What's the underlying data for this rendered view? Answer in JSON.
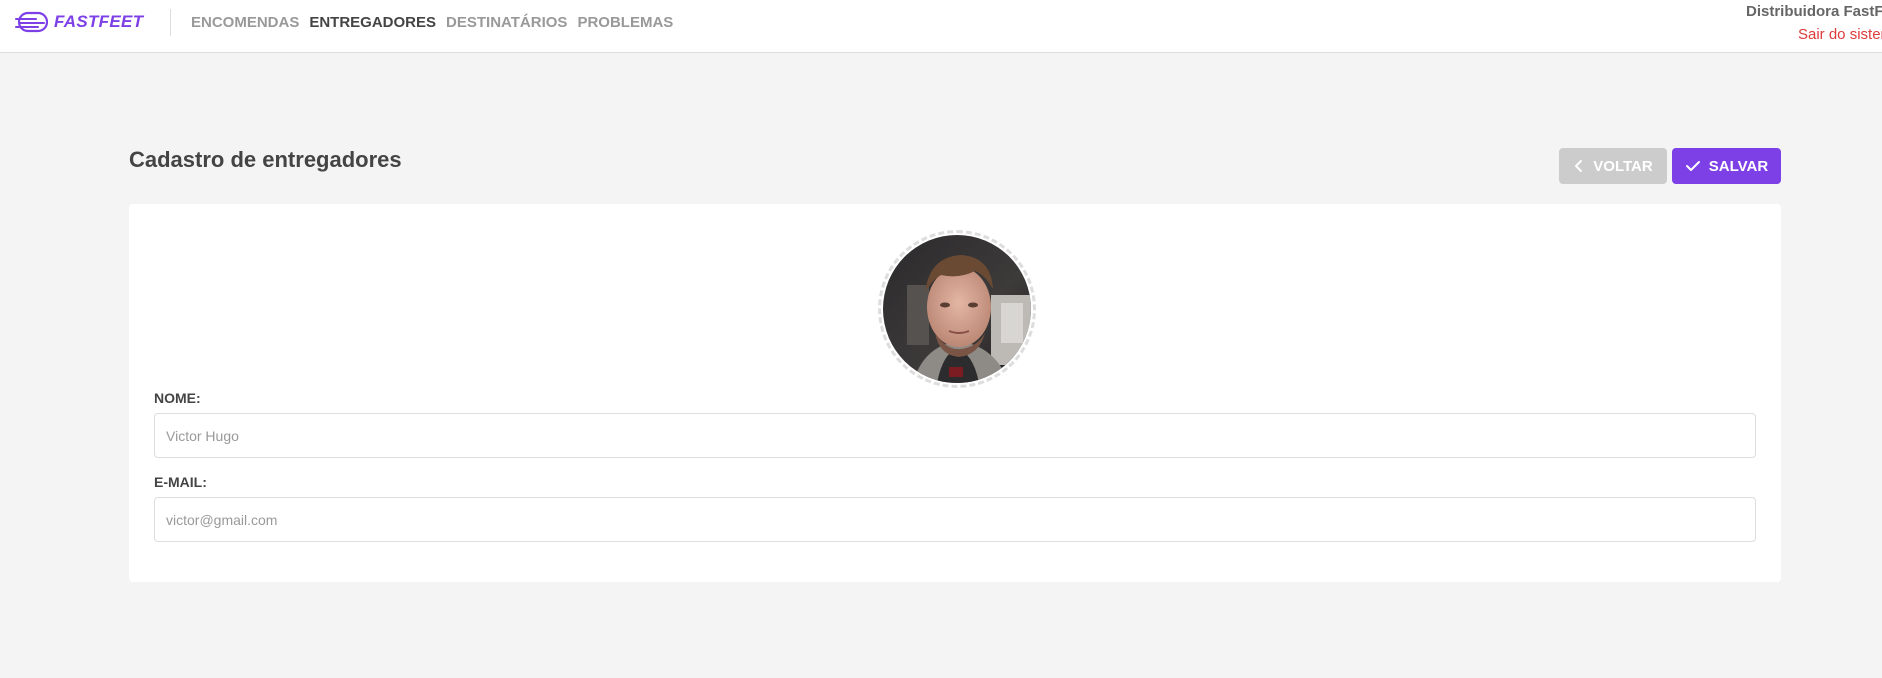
{
  "app": {
    "logo_text": "FASTFEET",
    "brand_color": "#7d40e7"
  },
  "nav": {
    "items": [
      {
        "label": "ENCOMENDAS",
        "active": false
      },
      {
        "label": "ENTREGADORES",
        "active": true
      },
      {
        "label": "DESTINATÁRIOS",
        "active": false
      },
      {
        "label": "PROBLEMAS",
        "active": false
      }
    ]
  },
  "profile": {
    "name": "Distribuidora FastFeet",
    "logout_label": "Sair do sistema",
    "logout_color": "#de3b3b"
  },
  "page": {
    "title": "Cadastro de entregadores"
  },
  "actions": {
    "back_label": "VOLTAR",
    "back_icon": "chevron-left-icon",
    "save_label": "SALVAR",
    "save_icon": "check-icon"
  },
  "form": {
    "avatar_alt": "avatar",
    "name_label": "NOME:",
    "name_placeholder": "Victor Hugo",
    "name_value": "",
    "email_label": "E-MAIL:",
    "email_placeholder": "victor@gmail.com",
    "email_value": ""
  }
}
